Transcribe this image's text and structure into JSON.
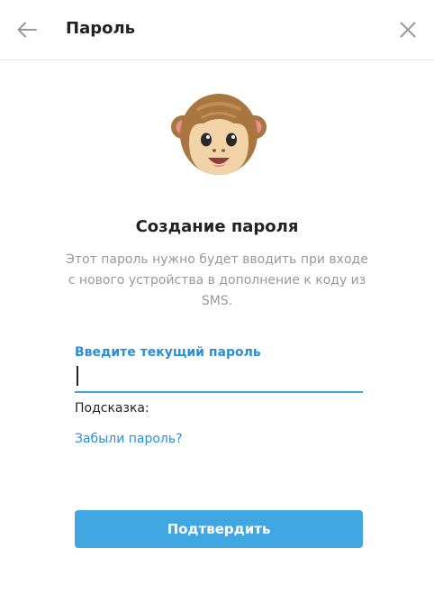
{
  "header": {
    "title": "Пароль",
    "back_icon": "arrow-left-icon",
    "close_icon": "close-icon"
  },
  "illustration": {
    "icon": "monkey-icon"
  },
  "content": {
    "title": "Создание пароля",
    "description": "Этот пароль нужно будет вводить при входе с нового устройства в дополнение к коду из SMS."
  },
  "form": {
    "password_label": "Введите текущий пароль",
    "password_value": "",
    "hint_label": "Подсказка:",
    "forgot_link": "Забыли пароль?"
  },
  "actions": {
    "confirm_label": "Подтвердить"
  },
  "colors": {
    "accent": "#40a7e3",
    "link": "#2b8fd6",
    "muted_text": "#999999"
  }
}
